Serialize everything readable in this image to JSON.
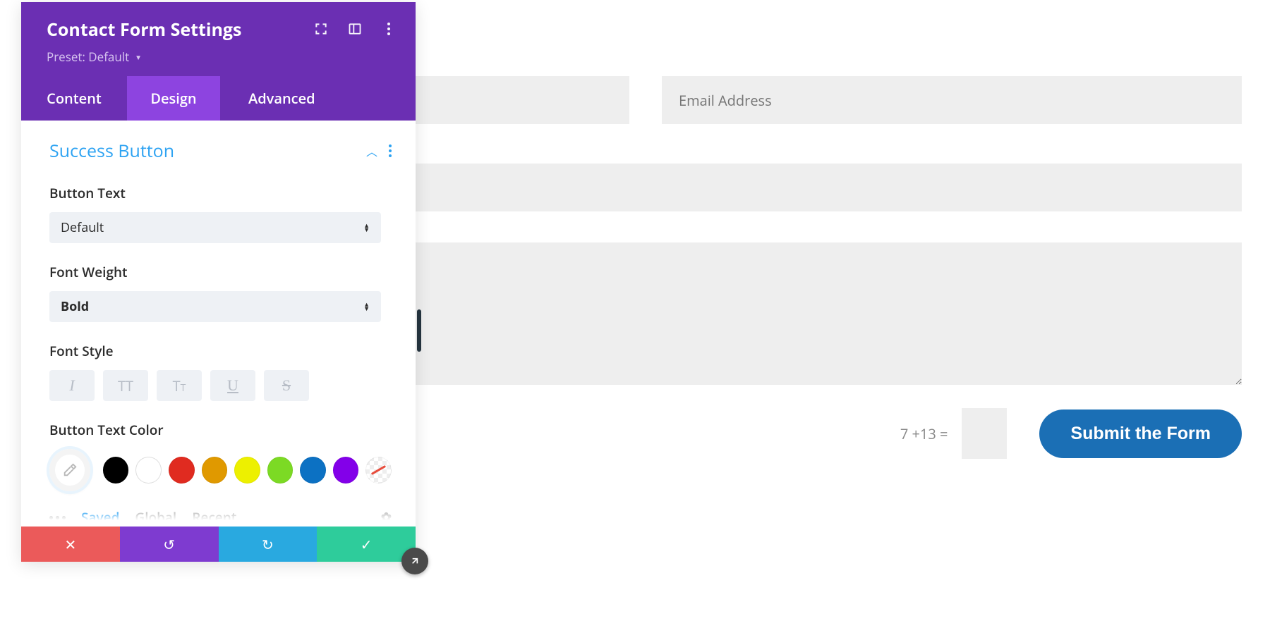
{
  "form": {
    "name_placeholder": "",
    "email_placeholder": "Email Address",
    "subject_placeholder": "",
    "message_placeholder": "",
    "captcha_question": "7 +13 =",
    "submit_label": "Submit the Form"
  },
  "modal": {
    "title": "Contact Form Settings",
    "preset_label": "Preset: Default",
    "tabs": {
      "content": "Content",
      "design": "Design",
      "advanced": "Advanced",
      "active": "design"
    },
    "section": {
      "title": "Success Button",
      "button_text": {
        "label": "Button Text",
        "value": "Default"
      },
      "font_weight": {
        "label": "Font Weight",
        "value": "Bold"
      },
      "font_style": {
        "label": "Font Style"
      },
      "button_text_color": {
        "label": "Button Text Color",
        "swatches": [
          "#000000",
          "#ffffff",
          "#e02b20",
          "#e09900",
          "#edf000",
          "#7cda24",
          "#0c71c3",
          "#8300e9"
        ],
        "palette_tabs": {
          "saved": "Saved",
          "global": "Global",
          "recent": "Recent",
          "active": "saved"
        }
      }
    }
  },
  "colors": {
    "accent": "#2ea3f2",
    "modal_header": "#6b2fb3",
    "tab_active": "#8d44e0",
    "submit": "#1b6fb5"
  }
}
